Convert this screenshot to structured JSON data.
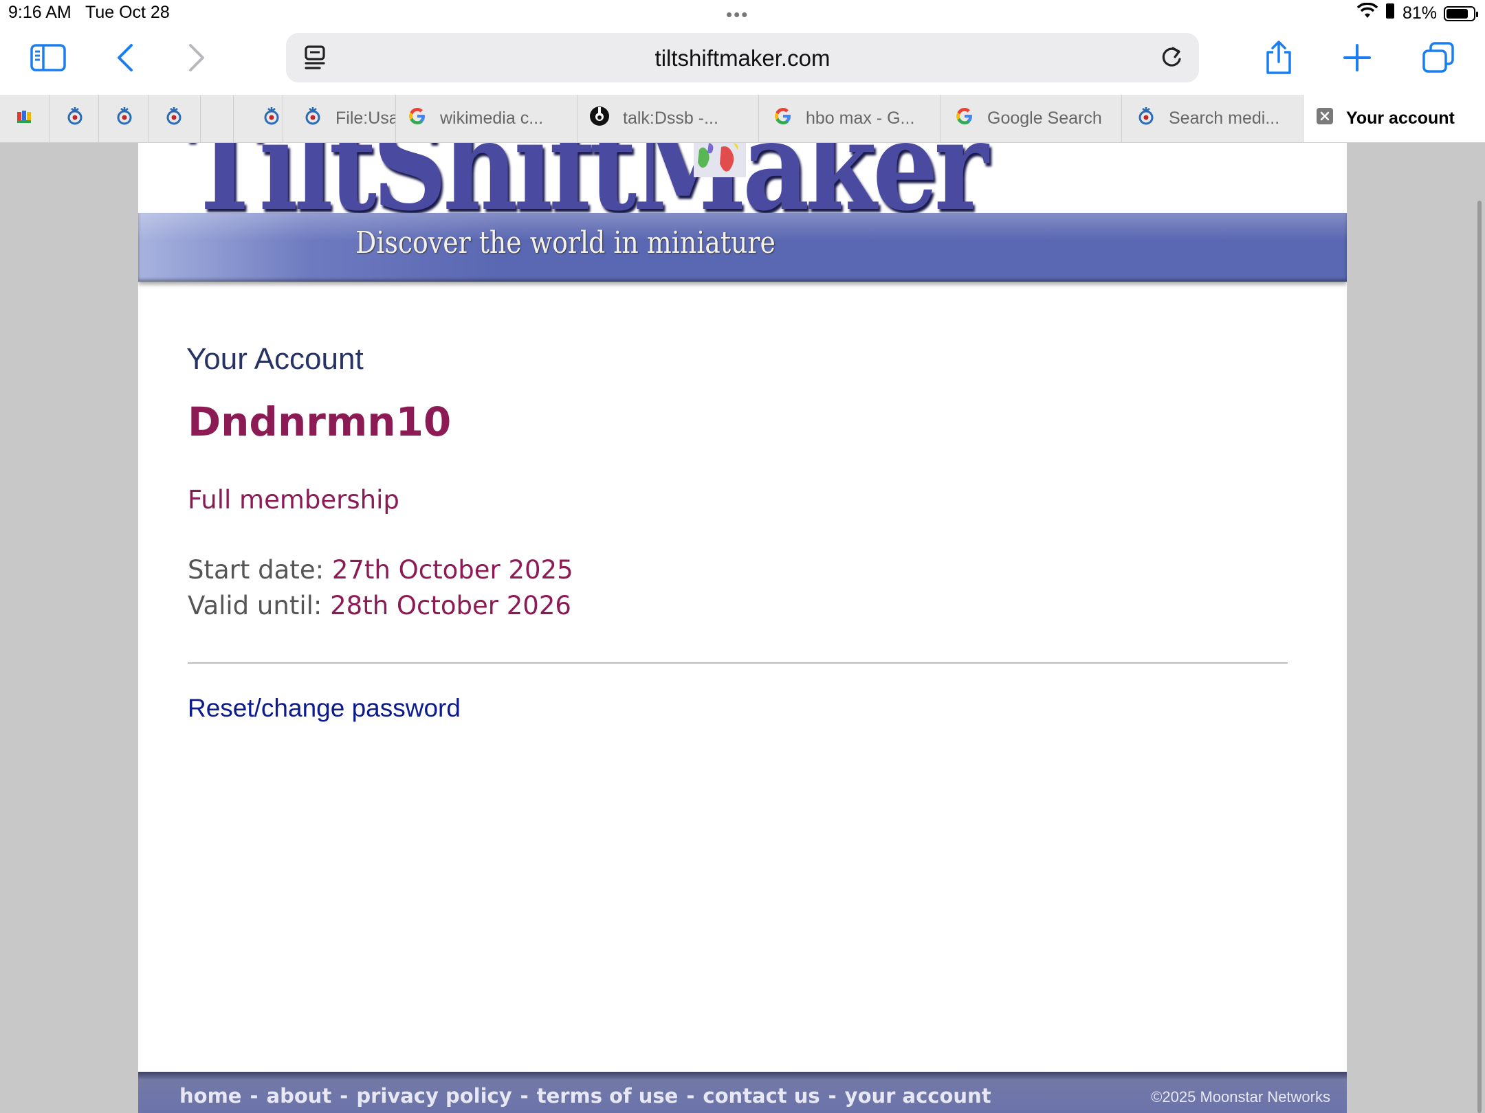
{
  "status_bar": {
    "time": "9:16 AM",
    "date": "Tue Oct 28",
    "battery": "81%",
    "battery_level": 0.81
  },
  "toolbar": {
    "url": "tiltshiftmaker.com",
    "icons": [
      "sidebar-icon",
      "back-icon",
      "forward-icon",
      "reader-icon",
      "reload-icon",
      "share-icon",
      "new-tab-icon",
      "tabs-overview-icon"
    ]
  },
  "tabs": [
    {
      "icon": "extension-icon",
      "label": ""
    },
    {
      "icon": "commons-icon",
      "label": ""
    },
    {
      "icon": "commons-icon",
      "label": ""
    },
    {
      "icon": "commons-icon",
      "label": ""
    },
    {
      "icon": "",
      "label": ""
    },
    {
      "icon": "commons-icon",
      "label": ""
    },
    {
      "icon": "commons-icon",
      "label": "File:Usa"
    },
    {
      "icon": "google-icon",
      "label": "wikimedia c..."
    },
    {
      "icon": "wikimedia-icon",
      "label": "talk:Dssb -..."
    },
    {
      "icon": "google-icon",
      "label": "hbo max - G..."
    },
    {
      "icon": "google-icon",
      "label": "Google Search"
    },
    {
      "icon": "commons-icon",
      "label": "Search medi..."
    },
    {
      "icon": "close-icon",
      "label": "Your account"
    }
  ],
  "site": {
    "logo_text": "TiltShiftMaker",
    "tagline": "Discover the world in miniature"
  },
  "account": {
    "heading": "Your Account",
    "username": "Dndnrmn10",
    "membership": "Full membership",
    "start_label": "Start date:",
    "start_value": "27th October 2025",
    "valid_label": "Valid until:",
    "valid_value": "28th October 2026",
    "reset_link": "Reset/change password"
  },
  "footer": {
    "links": [
      "home",
      "about",
      "privacy policy",
      "terms of use",
      "contact us",
      "your account"
    ],
    "separator": "-",
    "copyright": "©2025 Moonstar Networks"
  },
  "colors": {
    "accent": "#8b1a55",
    "link": "#0b1a8c",
    "safari_blue": "#1a7ef0",
    "banner": "#5a67b2"
  }
}
